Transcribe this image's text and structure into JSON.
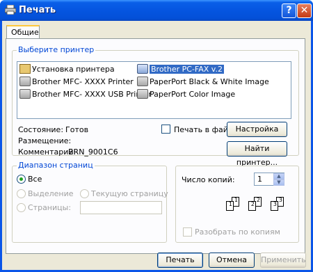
{
  "window": {
    "title": "Печать",
    "help_symbol": "?",
    "close_symbol": "✕"
  },
  "tabs": [
    {
      "label": "Общие"
    }
  ],
  "printer_group": {
    "label": "Выберите принтер",
    "printers": [
      {
        "name": "Установка принтера",
        "icon": "add-printer-icon"
      },
      {
        "name": "Brother MFC- XXXX  Printer",
        "icon": "printer-icon"
      },
      {
        "name": "Brother MFC- XXXX  USB Printer",
        "icon": "printer-icon"
      },
      {
        "name": "Brother PC-FAX v.2",
        "icon": "fax-icon",
        "selected": true
      },
      {
        "name": "PaperPort Black & White Image",
        "icon": "printer-icon"
      },
      {
        "name": "PaperPort Color Image",
        "icon": "printer-icon"
      }
    ],
    "status_label": "Состояние:",
    "status_value": "Готов",
    "location_label": "Размещение:",
    "location_value": "",
    "comment_label": "Комментарий:",
    "comment_value": "BRN_9001C6",
    "print_to_file_label": "Печать в файл",
    "settings_button": "Настройка",
    "find_printer_button": "Найти принтер..."
  },
  "range_group": {
    "label": "Диапазон страниц",
    "all": "Все",
    "selection": "Выделение",
    "current_page": "Текущую страницу",
    "pages": "Страницы:",
    "pages_value": ""
  },
  "copies": {
    "label": "Число копий:",
    "value": "1",
    "collate_label": "Разобрать по копиям",
    "page_numbers": [
      "1",
      "1",
      "2",
      "2",
      "3",
      "3"
    ]
  },
  "footer": {
    "print_button": "Печать",
    "cancel_button": "Отмена",
    "apply_button": "Применить"
  },
  "colors": {
    "titlebar": "#0a55e8",
    "accent": "#0046d5",
    "selection": "#316ac5",
    "face": "#ece9d8"
  }
}
